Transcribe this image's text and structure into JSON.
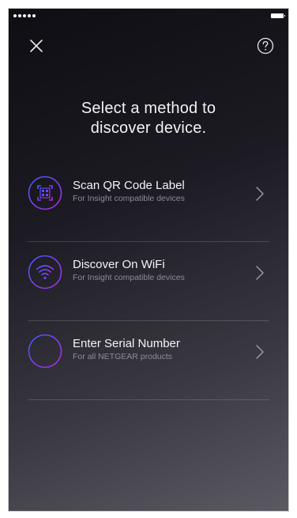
{
  "status_bar": {
    "signal_icon": "signal-dots-icon",
    "battery_icon": "battery-icon"
  },
  "toolbar": {
    "close_icon": "close-icon",
    "help_icon": "help-icon"
  },
  "heading": {
    "line1": "Select a method to",
    "line2": "discover device."
  },
  "methods": [
    {
      "title": "Scan QR Code Label",
      "subtitle": "For Insight compatible devices",
      "icon": "qr-scan-icon"
    },
    {
      "title": "Discover On WiFi",
      "subtitle": "For Insight compatible devices",
      "icon": "wifi-icon"
    },
    {
      "title": "Enter Serial Number",
      "subtitle": "For all NETGEAR products",
      "icon": "hash-icon"
    }
  ],
  "colors": {
    "accent_gradient_start": "#3d5bff",
    "accent_gradient_end": "#b02adf",
    "text_primary": "#f4f4f6",
    "text_secondary": "#8e8c96"
  }
}
